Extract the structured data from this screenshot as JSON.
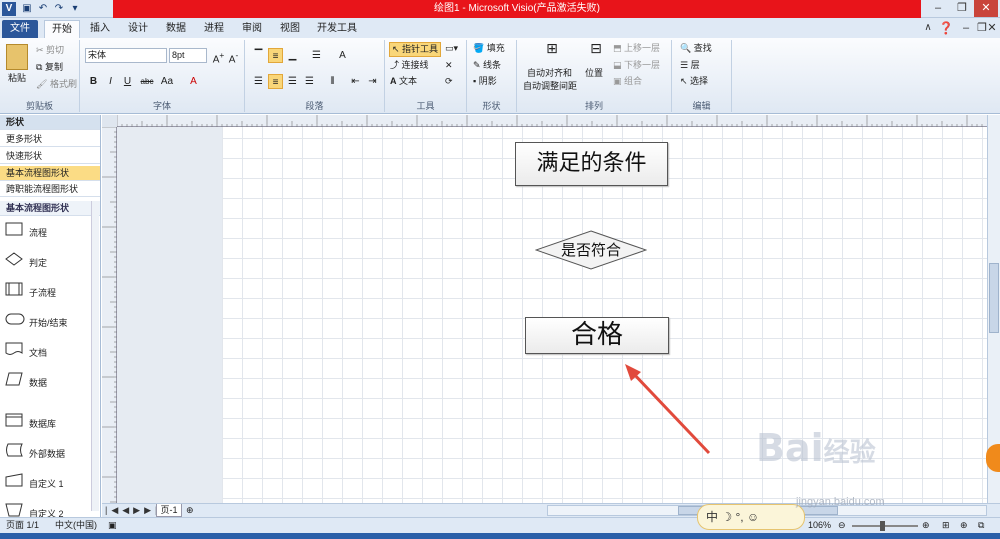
{
  "titlebar": {
    "title": "绘图1 - Microsoft Visio(产品激活失败)"
  },
  "tabs": [
    "文件",
    "开始",
    "插入",
    "设计",
    "数据",
    "进程",
    "审阅",
    "视图",
    "开发工具"
  ],
  "clipboard": {
    "paste": "粘贴",
    "cut": "剪切",
    "copy": "复制",
    "format_painter": "格式刷",
    "label": "剪贴板"
  },
  "font": {
    "name": "宋体",
    "size": "8pt",
    "label": "字体",
    "bold": "B",
    "italic": "I",
    "underline": "U",
    "strike": "abc",
    "case": "Aa"
  },
  "paragraph": {
    "label": "段落"
  },
  "tools": {
    "pointer": "指针工具",
    "connector": "连接线",
    "text": "文本",
    "label": "工具"
  },
  "shape": {
    "fill": "填充",
    "line": "线条",
    "shadow": "阴影",
    "label": "形状"
  },
  "arrange": {
    "autoalign": "自动对齐和",
    "autoalign2": "自动调整间距",
    "position": "位置",
    "bring_forward": "上移一层",
    "send_backward": "下移一层",
    "group": "组合",
    "label": "排列"
  },
  "editing": {
    "find": "查找",
    "layer": "层",
    "select": "选择",
    "label": "编辑"
  },
  "shapes_panel": {
    "title": "形状",
    "more": "更多形状",
    "quick": "快速形状",
    "basic": "基本流程图形状",
    "cross": "跨职能流程图形状",
    "stencil_title": "基本流程图形状",
    "items": [
      "流程",
      "判定",
      "子流程",
      "开始/结束",
      "文档",
      "数据",
      "数据库",
      "外部数据",
      "自定义 1",
      "自定义 2"
    ]
  },
  "diagram": {
    "box1": "满足的条件",
    "decision": "是否符合",
    "box2": "合格"
  },
  "pagebar": {
    "page_tab": "页-1"
  },
  "status": {
    "page": "页面 1/1",
    "lang": "中文(中国)",
    "zoom": "106%"
  },
  "watermark": {
    "brand": "Bai",
    "brand2": "经验",
    "url": "jingyan.baidu.com",
    "ime": "中"
  }
}
